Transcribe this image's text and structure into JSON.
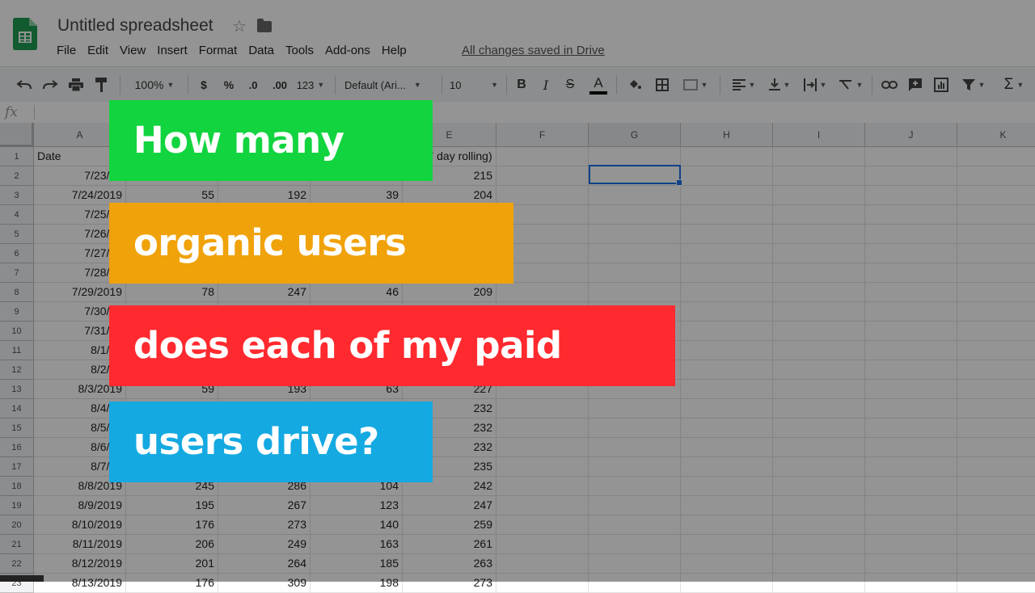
{
  "app": {
    "doc_title": "Untitled spreadsheet",
    "menu": [
      "File",
      "Edit",
      "View",
      "Insert",
      "Format",
      "Data",
      "Tools",
      "Add-ons",
      "Help"
    ],
    "save_status": "All changes saved in Drive"
  },
  "toolbar": {
    "zoom": "100%",
    "currency": "$",
    "percent": "%",
    "decimal_decrease": ".0",
    "decimal_increase": ".00",
    "number_format": "123",
    "font": "Default (Ari...",
    "font_size": "10",
    "bold": "B",
    "italic": "I",
    "strike": "S",
    "text_color": "A",
    "sum": "Σ"
  },
  "formula_bar": {
    "fx_label": "fx"
  },
  "grid": {
    "columns": [
      "A",
      "E",
      "F",
      "G",
      "H",
      "I",
      "J",
      "K"
    ],
    "row_numbers": [
      "1",
      "2",
      "3",
      "4",
      "5",
      "6",
      "7",
      "8",
      "9",
      "10",
      "11",
      "12",
      "13",
      "14",
      "15",
      "16",
      "17",
      "18",
      "19",
      "20",
      "21",
      "22",
      "23"
    ],
    "header_row": {
      "a": "Date",
      "e": "nic (7 day rolling)"
    },
    "rows": [
      {
        "a": "7/23/20",
        "b": "",
        "c": "",
        "d": "",
        "e": "215"
      },
      {
        "a": "7/24/2019",
        "b": "55",
        "c": "192",
        "d": "39",
        "e": "204"
      },
      {
        "a": "7/25/20",
        "b": "",
        "c": "",
        "d": "",
        "e": ""
      },
      {
        "a": "7/26/20",
        "b": "",
        "c": "",
        "d": "",
        "e": ""
      },
      {
        "a": "7/27/20",
        "b": "",
        "c": "",
        "d": "",
        "e": ""
      },
      {
        "a": "7/28/20",
        "b": "",
        "c": "",
        "d": "",
        "e": ""
      },
      {
        "a": "7/29/2019",
        "b": "78",
        "c": "247",
        "d": "46",
        "e": "209"
      },
      {
        "a": "7/30/20",
        "b": "",
        "c": "",
        "d": "",
        "e": ""
      },
      {
        "a": "7/31/20",
        "b": "",
        "c": "",
        "d": "",
        "e": ""
      },
      {
        "a": "8/1/20",
        "b": "",
        "c": "",
        "d": "",
        "e": ""
      },
      {
        "a": "8/2/20",
        "b": "",
        "c": "",
        "d": "",
        "e": ""
      },
      {
        "a": "8/3/2019",
        "b": "59",
        "c": "193",
        "d": "63",
        "e": "227"
      },
      {
        "a": "8/4/20",
        "b": "",
        "c": "",
        "d": "",
        "e": "232"
      },
      {
        "a": "8/5/20",
        "b": "",
        "c": "",
        "d": "",
        "e": "232"
      },
      {
        "a": "8/6/20",
        "b": "",
        "c": "",
        "d": "",
        "e": "232"
      },
      {
        "a": "8/7/20",
        "b": "",
        "c": "",
        "d": "",
        "e": "235"
      },
      {
        "a": "8/8/2019",
        "b": "245",
        "c": "286",
        "d": "104",
        "e": "242"
      },
      {
        "a": "8/9/2019",
        "b": "195",
        "c": "267",
        "d": "123",
        "e": "247"
      },
      {
        "a": "8/10/2019",
        "b": "176",
        "c": "273",
        "d": "140",
        "e": "259"
      },
      {
        "a": "8/11/2019",
        "b": "206",
        "c": "249",
        "d": "163",
        "e": "261"
      },
      {
        "a": "8/12/2019",
        "b": "201",
        "c": "264",
        "d": "185",
        "e": "263"
      },
      {
        "a": "8/13/2019",
        "b": "176",
        "c": "309",
        "d": "198",
        "e": "273"
      }
    ]
  },
  "overlay_text": {
    "line1": "How many",
    "line2": "organic users",
    "line3": "does each of my paid",
    "line4": "users drive?"
  },
  "colors": {
    "green": "#12d43f",
    "orange": "#f0a20a",
    "red": "#ff2a2f",
    "blue": "#14a9e1"
  }
}
